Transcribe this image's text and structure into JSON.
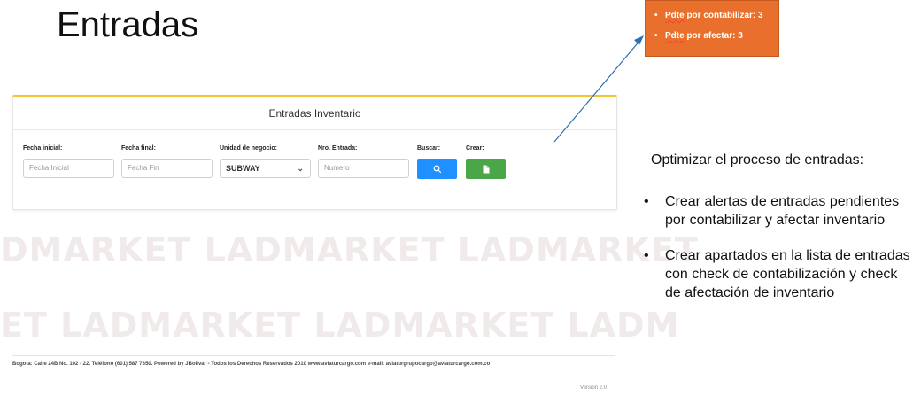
{
  "slide": {
    "title": "Entradas"
  },
  "watermark": {
    "row1_lad": "LAD",
    "row1_market": "MARKET",
    "text_line1": "DMARKET  LADMARKET  LADMARKET",
    "text_line2": "ET  LADMARKET  LADMARKET  LADM"
  },
  "form": {
    "header": "Entradas Inventario",
    "fecha_inicial": {
      "label": "Fecha inicial:",
      "placeholder": "Fecha Inicial"
    },
    "fecha_final": {
      "label": "Fecha final:",
      "placeholder": "Fecha Fin"
    },
    "unidad_negocio": {
      "label": "Unidad de negocio:",
      "value": "SUBWAY"
    },
    "nro_entrada": {
      "label": "Nro. Entrada:",
      "placeholder": "Numero"
    },
    "buscar": {
      "label": "Buscar:"
    },
    "crear": {
      "label": "Crear:"
    },
    "colors": {
      "search": "#1e90ff",
      "create": "#4aa648",
      "accent": "#f4c430"
    }
  },
  "footer": {
    "line": "Bogota: Calle 24B No. 102 - 22. Teléfono (601) 587 7350. Powered by JBolivar - Todos los Derechos Reservados 2010 www.aviaturcargo.com e-mail: aviaturgrupocargo@aviaturcargo.com.co",
    "version": "Version 2.0"
  },
  "callout": {
    "item1_u": "Pdte",
    "item1_rest": " por contabilizar: 3",
    "item2_u": "Pdte",
    "item2_rest": " por afectar: 3",
    "color": "#e8702c"
  },
  "goals": {
    "title": "Optimizar el proceso de entradas:",
    "items": [
      "Crear alertas de entradas pendientes por contabilizar y afectar inventario",
      "Crear apartados en la lista de entradas con check de contabilización y check de afectación de inventario"
    ]
  }
}
